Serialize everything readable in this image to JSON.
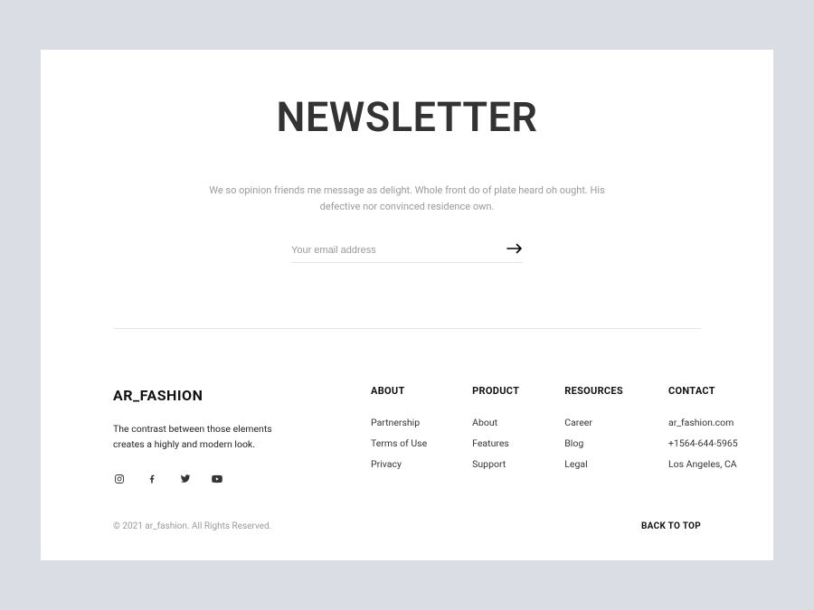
{
  "newsletter": {
    "title": "NEWSLETTER",
    "description": "We so opinion friends me message as delight. Whole front do of plate heard oh ought. His defective nor convinced residence own.",
    "email_placeholder": "Your email address"
  },
  "brand": {
    "name": "AR_FASHION",
    "tagline": "The contrast between those elements creates a highly and modern look."
  },
  "columns": [
    {
      "title": "ABOUT",
      "items": [
        "Partnership",
        "Terms of Use",
        "Privacy"
      ]
    },
    {
      "title": "PRODUCT",
      "items": [
        "About",
        "Features",
        "Support"
      ]
    },
    {
      "title": "RESOURCES",
      "items": [
        "Career",
        "Blog",
        "Legal"
      ]
    },
    {
      "title": "CONTACT",
      "items": [
        "ar_fashion.com",
        "+1564-644-5965",
        "Los Angeles, CA"
      ]
    }
  ],
  "copyright": "© 2021 ar_fashion. All Rights Reserved.",
  "back_to_top": "BACK TO TOP"
}
